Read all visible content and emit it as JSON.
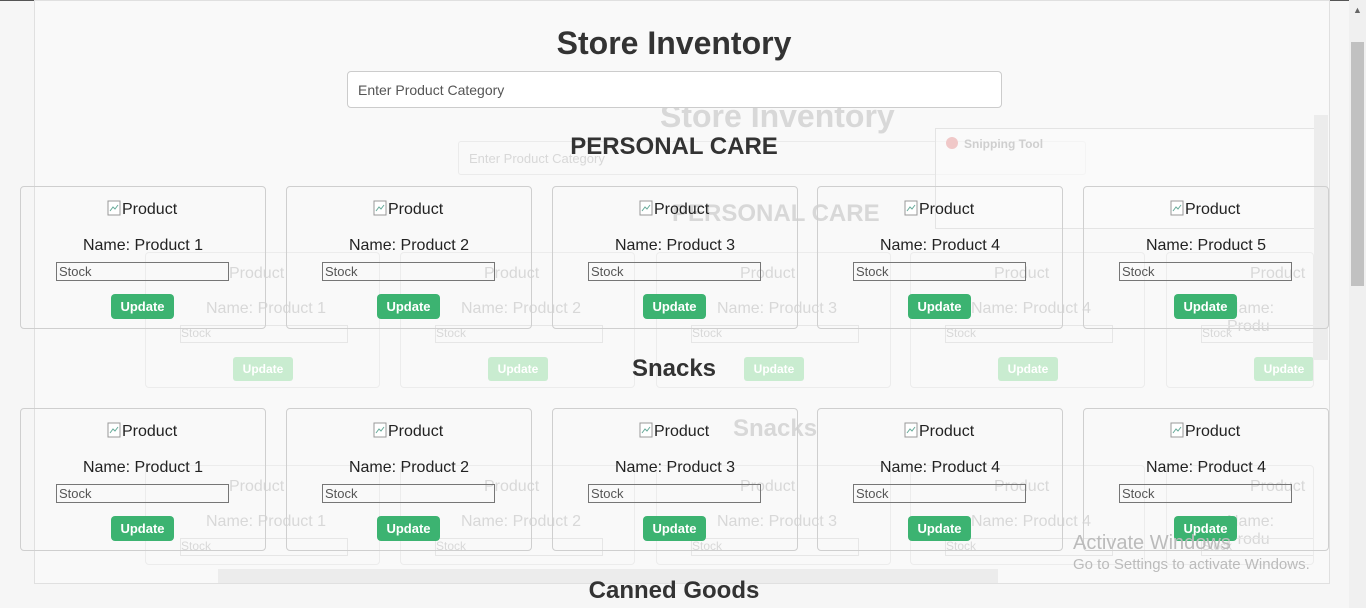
{
  "app": {
    "title": "Store Inventory",
    "search_placeholder": "Enter Product Category"
  },
  "categories": [
    {
      "name": "PERSONAL CARE",
      "products": [
        {
          "img_alt": "Product",
          "name": "Name: Product 1",
          "stock_placeholder": "Stock",
          "button": "Update"
        },
        {
          "img_alt": "Product",
          "name": "Name: Product 2",
          "stock_placeholder": "Stock",
          "button": "Update"
        },
        {
          "img_alt": "Product",
          "name": "Name: Product 3",
          "stock_placeholder": "Stock",
          "button": "Update"
        },
        {
          "img_alt": "Product",
          "name": "Name: Product 4",
          "stock_placeholder": "Stock",
          "button": "Update"
        },
        {
          "img_alt": "Product",
          "name": "Name: Product 5",
          "stock_placeholder": "Stock",
          "button": "Update"
        }
      ]
    },
    {
      "name": "Snacks",
      "products": [
        {
          "img_alt": "Product",
          "name": "Name: Product 1",
          "stock_placeholder": "Stock",
          "button": "Update"
        },
        {
          "img_alt": "Product",
          "name": "Name: Product 2",
          "stock_placeholder": "Stock",
          "button": "Update"
        },
        {
          "img_alt": "Product",
          "name": "Name: Product 3",
          "stock_placeholder": "Stock",
          "button": "Update"
        },
        {
          "img_alt": "Product",
          "name": "Name: Product 4",
          "stock_placeholder": "Stock",
          "button": "Update"
        },
        {
          "img_alt": "Product",
          "name": "Name: Product 4",
          "stock_placeholder": "Stock",
          "button": "Update"
        }
      ]
    },
    {
      "name": "Canned Goods",
      "products": []
    }
  ],
  "background_window": {
    "title": "Store Inventory",
    "search_placeholder": "Enter Product Category",
    "category1": "PERSONAL CARE",
    "category2": "Snacks",
    "snipping_tool": "Snipping Tool",
    "row1": [
      {
        "img_alt": "Product",
        "name": "Name: Product 1",
        "stock": "Stock",
        "button": "Update"
      },
      {
        "img_alt": "Product",
        "name": "Name: Product 2",
        "stock": "Stock",
        "button": "Update"
      },
      {
        "img_alt": "Product",
        "name": "Name: Product 3",
        "stock": "Stock",
        "button": "Update"
      },
      {
        "img_alt": "Product",
        "name": "Name: Product 4",
        "stock": "Stock",
        "button": "Update"
      },
      {
        "img_alt": "Product",
        "name": "Name: Produ",
        "stock": "Stock",
        "button": "Update"
      }
    ],
    "row2": [
      {
        "img_alt": "Product",
        "name": "Name: Product 1",
        "stock": "Stock"
      },
      {
        "img_alt": "Product",
        "name": "Name: Product 2",
        "stock": "Stock"
      },
      {
        "img_alt": "Product",
        "name": "Name: Product 3",
        "stock": "Stock"
      },
      {
        "img_alt": "Product",
        "name": "Name: Product 4",
        "stock": "Stock"
      },
      {
        "img_alt": "Product",
        "name": "Name: Produ",
        "stock": "Stock"
      }
    ]
  },
  "watermark": {
    "line1": "Activate Windows",
    "line2": "Go to Settings to activate Windows."
  },
  "colors": {
    "button": "#3cb371",
    "text": "#333333"
  }
}
